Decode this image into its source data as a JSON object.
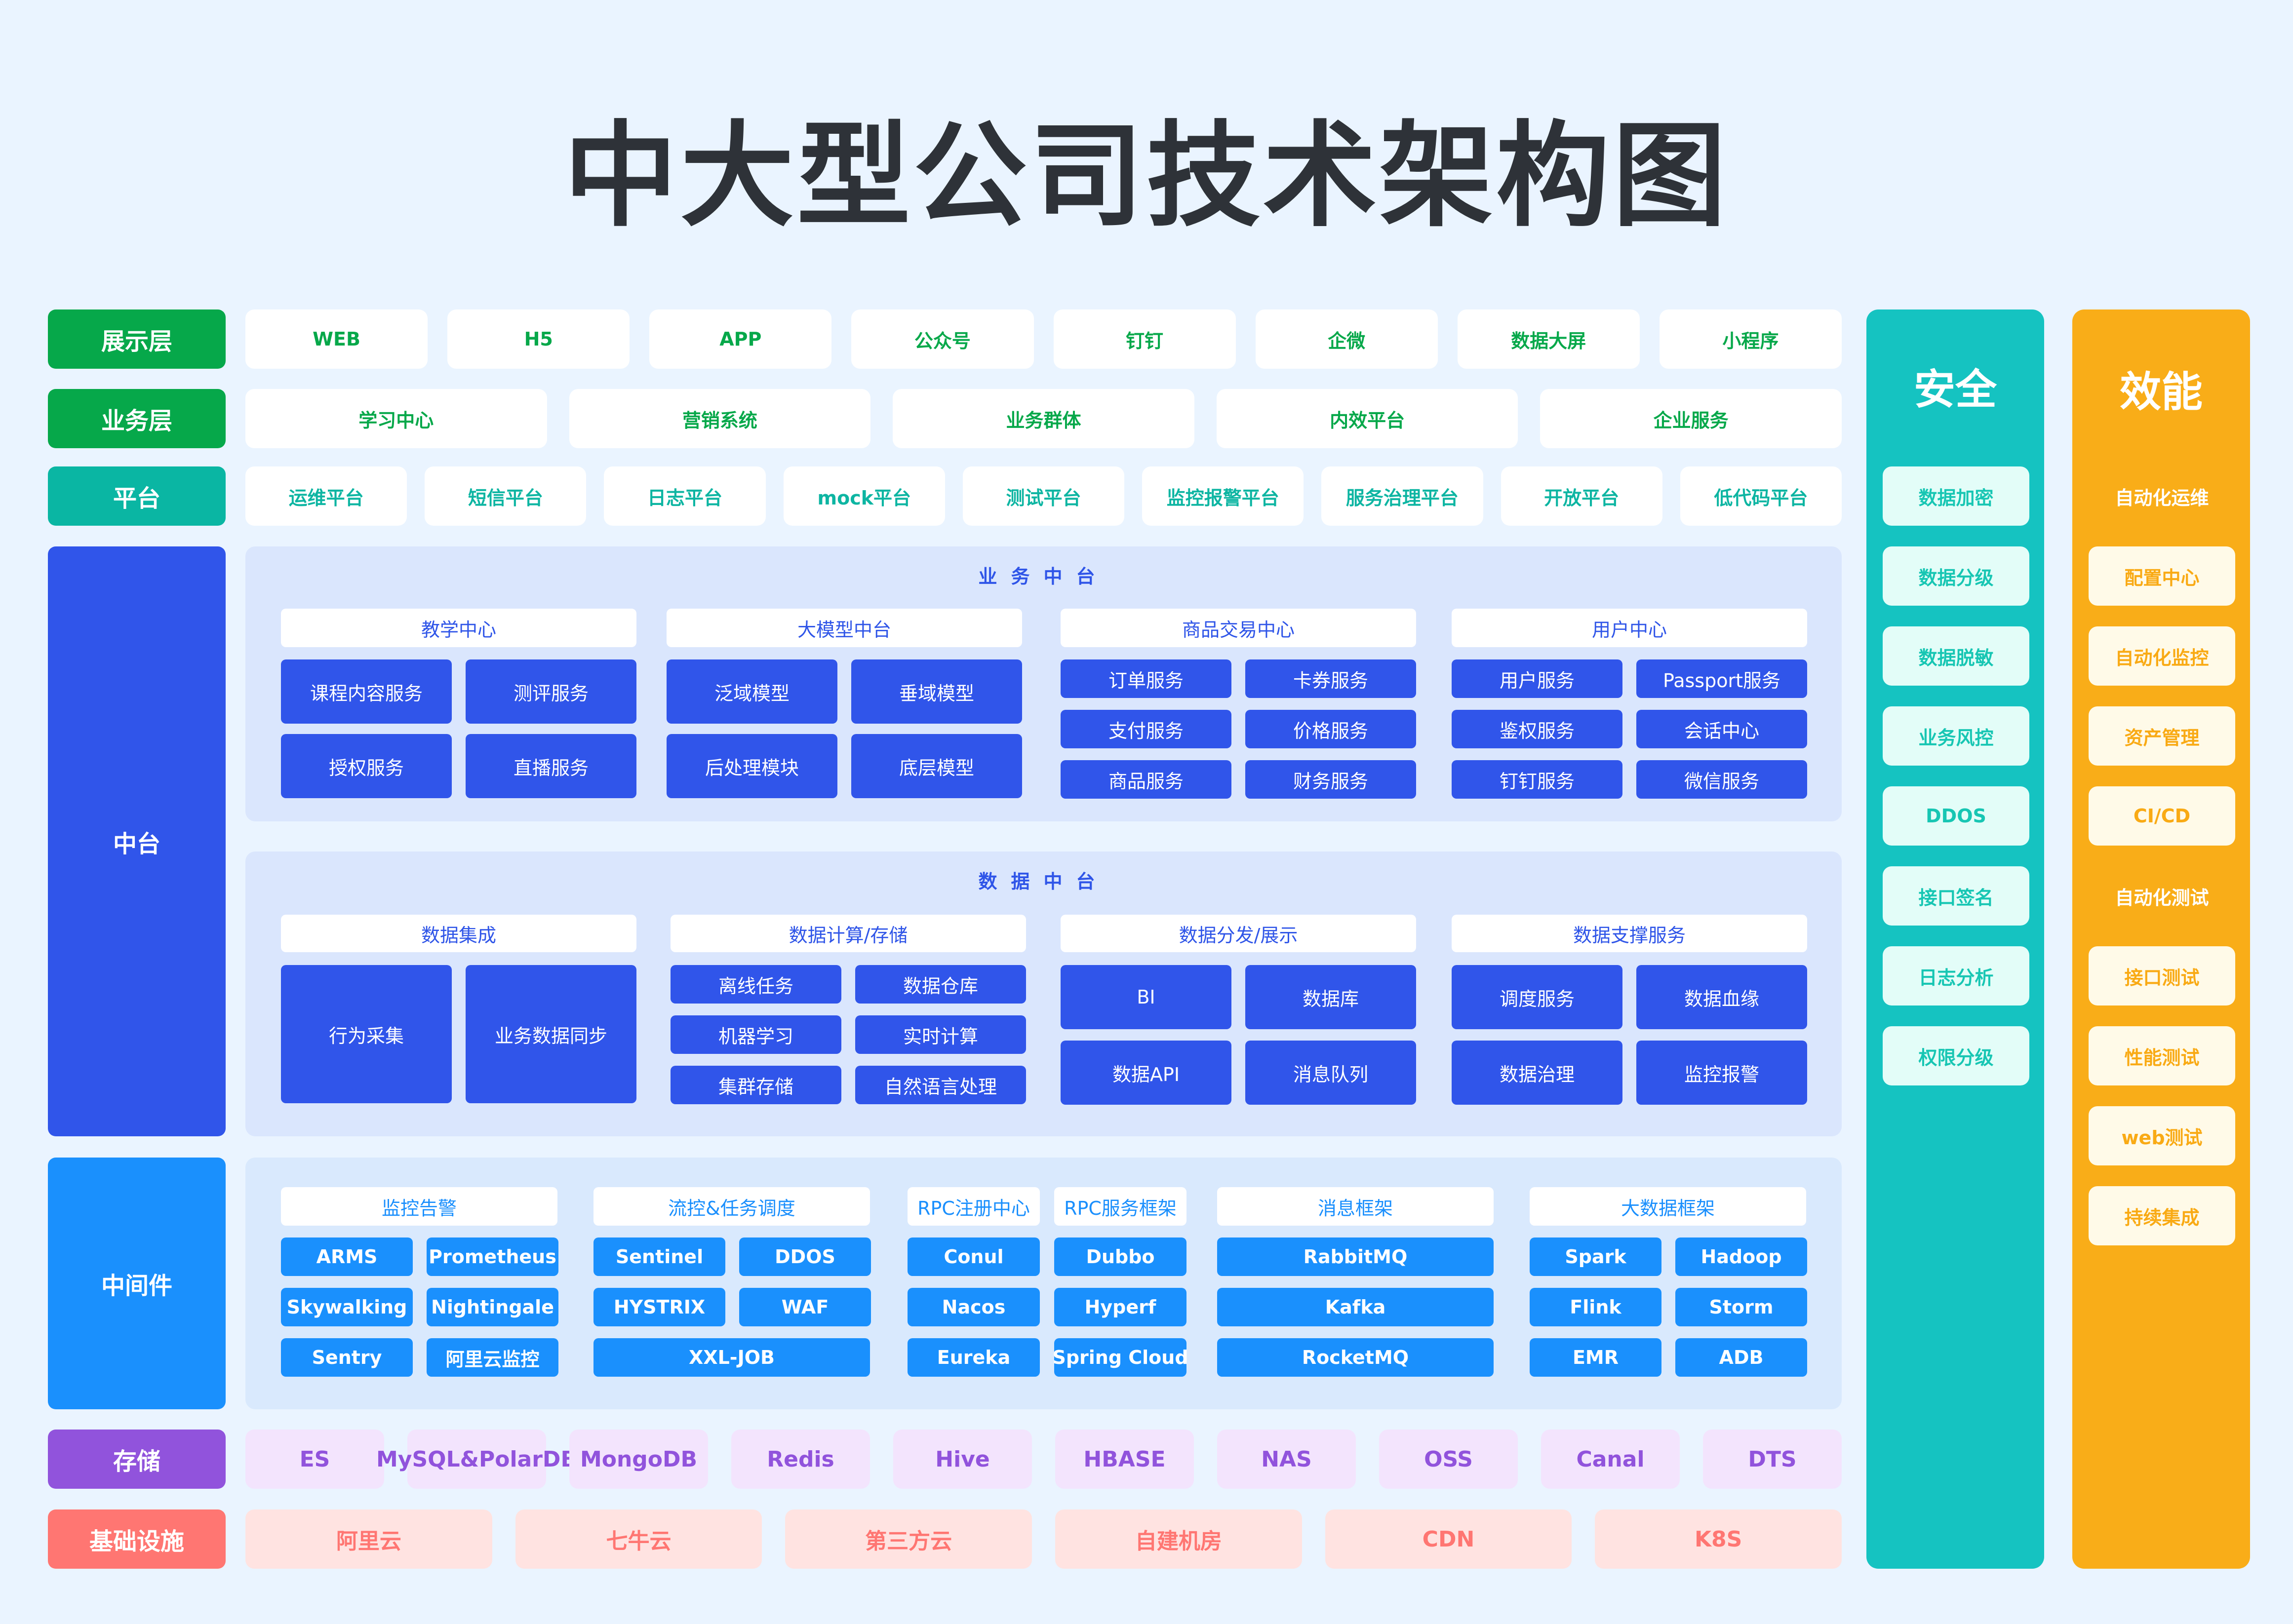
{
  "title": "中大型公司技术架构图",
  "colors": {
    "background": "#eaf4ff",
    "presentation": "#06a84a",
    "business": "#06a84a",
    "platform": "#0ab6a3",
    "middle": "#3055ea",
    "middleware": "#1a90fd",
    "storage": "#9153dc",
    "infra": "#ff7672",
    "security": "#15c3c1",
    "efficiency": "#f9ad18"
  },
  "layers": {
    "presentation": {
      "label": "展示层",
      "items": [
        "WEB",
        "H5",
        "APP",
        "公众号",
        "钉钉",
        "企微",
        "数据大屏",
        "小程序"
      ]
    },
    "business": {
      "label": "业务层",
      "items": [
        "学习中心",
        "营销系统",
        "业务群体",
        "内效平台",
        "企业服务"
      ]
    },
    "platform": {
      "label": "平台",
      "items": [
        "运维平台",
        "短信平台",
        "日志平台",
        "mock平台",
        "测试平台",
        "监控报警平台",
        "服务治理平台",
        "开放平台",
        "低代码平台"
      ]
    },
    "middle": {
      "label": "中台",
      "business_center": {
        "title": "业务中台",
        "groups": [
          {
            "header": "教学中心",
            "items": [
              "课程内容服务",
              "测评服务",
              "授权服务",
              "直播服务"
            ]
          },
          {
            "header": "大模型中台",
            "items": [
              "泛域模型",
              "垂域模型",
              "后处理模块",
              "底层模型"
            ]
          },
          {
            "header": "商品交易中心",
            "items": [
              "订单服务",
              "卡券服务",
              "支付服务",
              "价格服务",
              "商品服务",
              "财务服务"
            ]
          },
          {
            "header": "用户中心",
            "items": [
              "用户服务",
              "Passport服务",
              "鉴权服务",
              "会话中心",
              "钉钉服务",
              "微信服务"
            ]
          }
        ]
      },
      "data_center": {
        "title": "数据中台",
        "groups": [
          {
            "header": "数据集成",
            "items": [
              "行为采集",
              "业务数据同步"
            ]
          },
          {
            "header": "数据计算/存储",
            "items": [
              "离线任务",
              "数据仓库",
              "机器学习",
              "实时计算",
              "集群存储",
              "自然语言处理"
            ]
          },
          {
            "header": "数据分发/展示",
            "items": [
              "BI",
              "数据库",
              "数据API",
              "消息队列"
            ]
          },
          {
            "header": "数据支撑服务",
            "items": [
              "调度服务",
              "数据血缘",
              "数据治理",
              "监控报警"
            ]
          }
        ]
      }
    },
    "middleware": {
      "label": "中间件",
      "groups": [
        {
          "header": "监控告警",
          "items": [
            "ARMS",
            "Prometheus",
            "Skywalking",
            "Nightingale",
            "Sentry",
            "阿里云监控"
          ]
        },
        {
          "header": "流控&任务调度",
          "items": [
            "Sentinel",
            "DDOS",
            "HYSTRIX",
            "WAF",
            "XXL-JOB"
          ]
        },
        {
          "header": "RPC注册中心",
          "items": [
            "Conul",
            "Nacos",
            "Eureka"
          ]
        },
        {
          "header": "RPC服务框架",
          "items": [
            "Dubbo",
            "Hyperf",
            "Spring Cloud"
          ]
        },
        {
          "header": "消息框架",
          "items": [
            "RabbitMQ",
            "Kafka",
            "RocketMQ"
          ]
        },
        {
          "header": "大数据框架",
          "items": [
            "Spark",
            "Hadoop",
            "Flink",
            "Storm",
            "EMR",
            "ADB"
          ]
        }
      ]
    },
    "storage": {
      "label": "存储",
      "items": [
        "ES",
        "MySQL&PolarDB",
        "MongoDB",
        "Redis",
        "Hive",
        "HBASE",
        "NAS",
        "OSS",
        "Canal",
        "DTS"
      ]
    },
    "infra": {
      "label": "基础设施",
      "items": [
        "阿里云",
        "七牛云",
        "第三方云",
        "自建机房",
        "CDN",
        "K8S"
      ]
    }
  },
  "security": {
    "title": "安全",
    "items": [
      "数据加密",
      "数据分级",
      "数据脱敏",
      "业务风控",
      "DDOS",
      "接口签名",
      "日志分析",
      "权限分级"
    ]
  },
  "efficiency": {
    "title": "效能",
    "sections": [
      {
        "label": "自动化运维",
        "items": [
          "配置中心",
          "自动化监控",
          "资产管理",
          "CI/CD"
        ]
      },
      {
        "label": "自动化测试",
        "items": [
          "接口测试",
          "性能测试",
          "web测试",
          "持续集成"
        ]
      }
    ]
  }
}
